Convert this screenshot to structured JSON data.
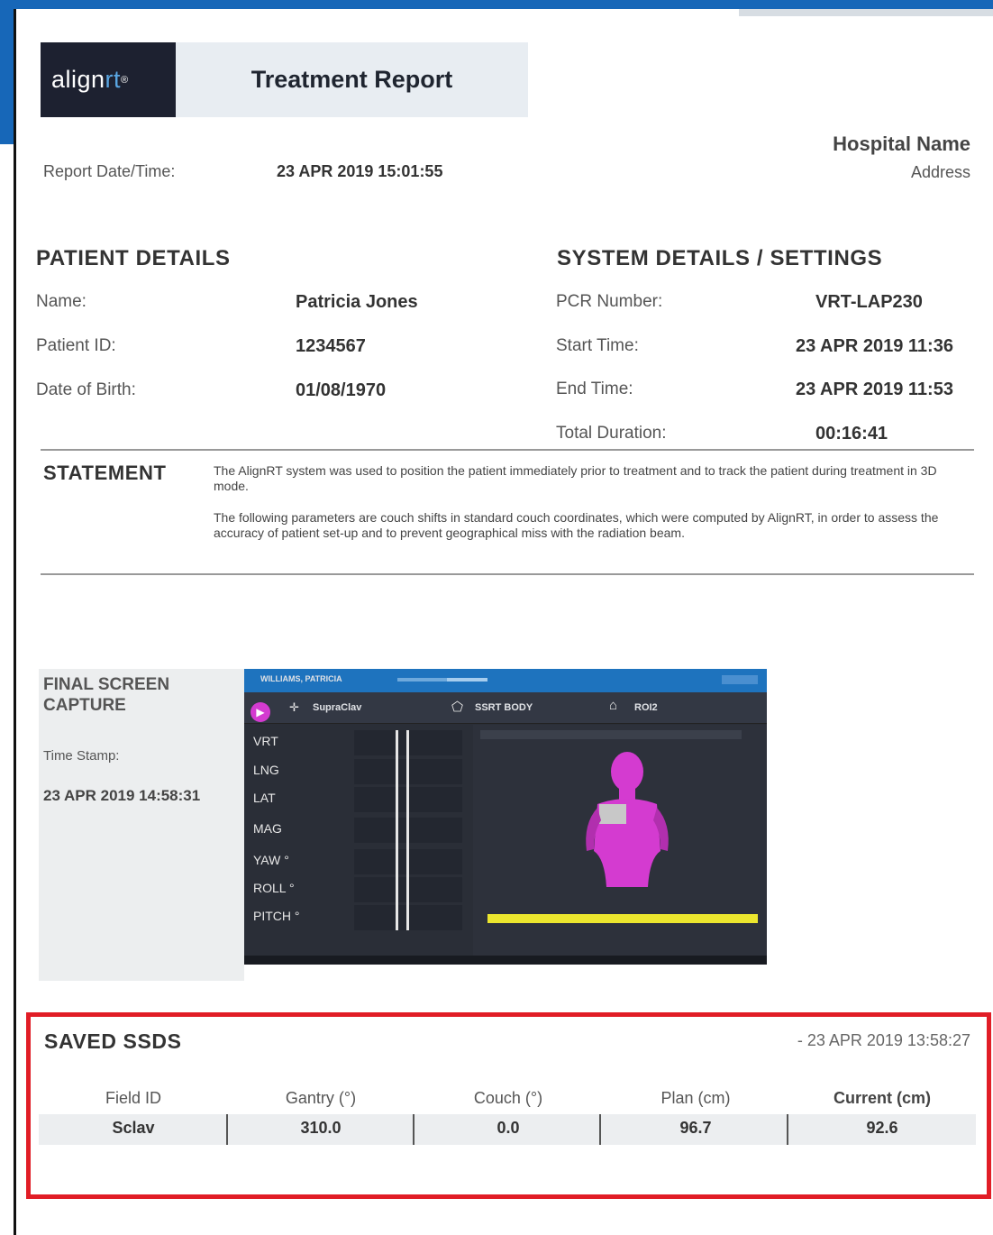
{
  "header": {
    "logo_text_a": "align",
    "logo_text_b": "rt",
    "logo_mark": "®",
    "title": "Treatment Report"
  },
  "report": {
    "date_label": "Report Date/Time:",
    "date_value": "23 APR 2019 15:01:55",
    "hospital_name": "Hospital Name",
    "hospital_address": "Address"
  },
  "patient": {
    "heading": "PATIENT DETAILS",
    "name_label": "Name:",
    "name_value": "Patricia Jones",
    "id_label": "Patient ID:",
    "id_value": "1234567",
    "dob_label": "Date of Birth:",
    "dob_value": "01/08/1970"
  },
  "system": {
    "heading": "SYSTEM DETAILS / SETTINGS",
    "pcr_label": "PCR Number:",
    "pcr_value": "VRT-LAP230",
    "start_label": "Start Time:",
    "start_value": "23 APR 2019 11:36",
    "end_label": "End Time:",
    "end_value": "23 APR 2019 11:53",
    "duration_label": "Total Duration:",
    "duration_value": "00:16:41"
  },
  "statement": {
    "heading": "STATEMENT",
    "para1": "The AlignRT system was used to position the patient immediately prior to treatment and to track the patient during treatment in 3D mode.",
    "para2": "The following parameters are couch shifts in standard couch coordinates, which were computed by AlignRT, in order to assess the accuracy of patient set-up and to prevent geographical miss with the radiation beam."
  },
  "capture": {
    "heading_line1": "FINAL SCREEN",
    "heading_line2": "CAPTURE",
    "timestamp_label": "Time Stamp:",
    "timestamp_value": "23 APR 2019 14:58:31",
    "screen": {
      "patient_header": "WILLIAMS, PATRICIA",
      "region_a": "SupraClav",
      "region_b": "SSRT BODY",
      "region_c": "ROI2",
      "axes": [
        "VRT",
        "LNG",
        "LAT",
        "MAG",
        "YAW °",
        "ROLL °",
        "PITCH °"
      ]
    }
  },
  "ssds": {
    "heading": "SAVED SSDS",
    "timestamp": "- 23 APR 2019 13:58:27",
    "columns": [
      "Field ID",
      "Gantry (°)",
      "Couch (°)",
      "Plan (cm)",
      "Current (cm)"
    ],
    "rows": [
      [
        "Sclav",
        "310.0",
        "0.0",
        "96.7",
        "92.6"
      ]
    ]
  },
  "colors": {
    "accent_blue": "#1767b8",
    "highlight_red": "#e11d26",
    "logo_dark": "#1d2130",
    "surface_magenta": "#d43bd0",
    "bar_yellow": "#ece62e"
  }
}
